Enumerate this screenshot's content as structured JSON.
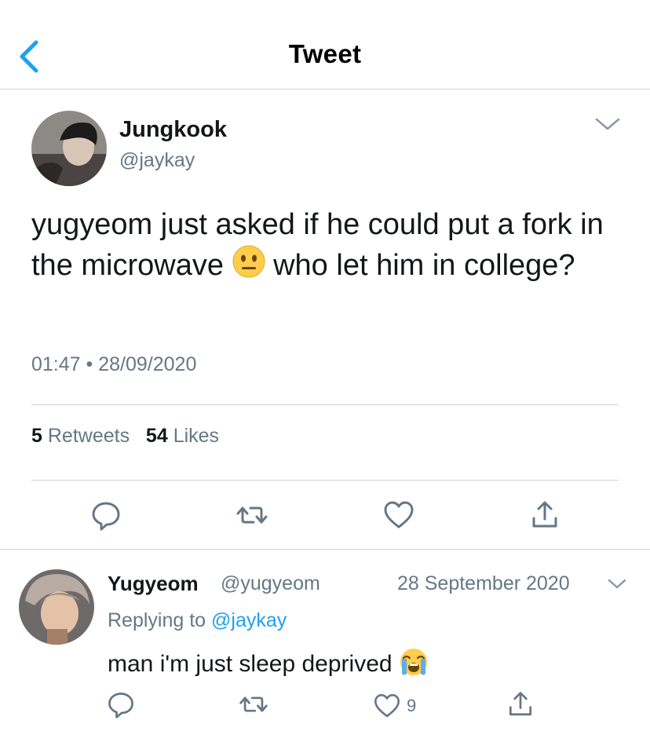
{
  "nav": {
    "title": "Tweet",
    "back_icon": "chevron-left-icon",
    "accent": "#1da1f2"
  },
  "tweet": {
    "author_name": "Jungkook",
    "author_handle": "@jaykay",
    "text_part1": "yugyeom just asked if he could put a fork in the microwave",
    "emoji": "neutral-face-emoji",
    "text_part2": "who let him in college?",
    "time": "01:47",
    "separator": "•",
    "date": "28/09/2020",
    "retweets_count": "5",
    "retweets_label": "Retweets",
    "likes_count": "54",
    "likes_label": "Likes",
    "actions": [
      "reply-icon",
      "retweet-icon",
      "like-icon",
      "share-icon"
    ]
  },
  "reply": {
    "author_name": "Yugyeom",
    "author_handle": "@yugyeom",
    "date": "28 September 2020",
    "replying_prefix": "Replying to",
    "replying_to": "@jaykay",
    "text": "man i'm just sleep deprived",
    "emoji": "loudly-crying-face-emoji",
    "like_count": "9",
    "actions": [
      "reply-icon",
      "retweet-icon",
      "like-icon",
      "share-icon"
    ]
  },
  "colors": {
    "text": "#14171a",
    "secondary": "#657786",
    "divider": "#d0d4d8",
    "link": "#1da1f2",
    "icon": "#657786"
  }
}
